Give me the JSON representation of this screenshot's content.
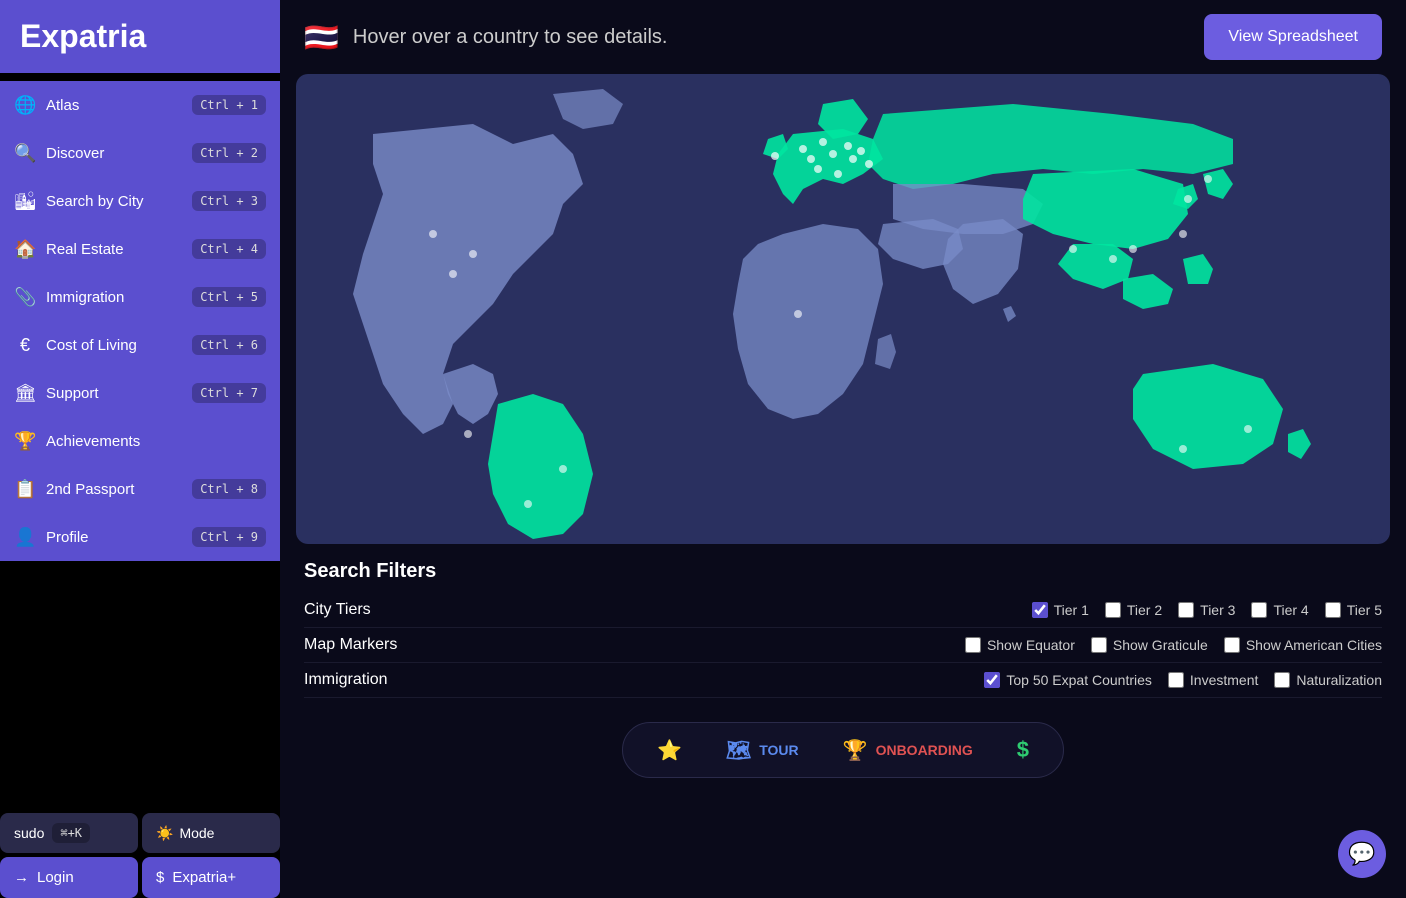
{
  "app": {
    "title": "Expatria"
  },
  "sidebar": {
    "items": [
      {
        "id": "atlas",
        "label": "Atlas",
        "icon": "🌐",
        "shortcut": "Ctrl + 1"
      },
      {
        "id": "discover",
        "label": "Discover",
        "icon": "🔍",
        "shortcut": "Ctrl + 2"
      },
      {
        "id": "search-by-city",
        "label": "Search by City",
        "icon": "🏙",
        "shortcut": "Ctrl + 3"
      },
      {
        "id": "real-estate",
        "label": "Real Estate",
        "icon": "🏠",
        "shortcut": "Ctrl + 4"
      },
      {
        "id": "immigration",
        "label": "Immigration",
        "icon": "📎",
        "shortcut": "Ctrl + 5"
      },
      {
        "id": "cost-of-living",
        "label": "Cost of Living",
        "icon": "€",
        "shortcut": "Ctrl + 6"
      },
      {
        "id": "support",
        "label": "Support",
        "icon": "🏛",
        "shortcut": "Ctrl + 7"
      },
      {
        "id": "achievements",
        "label": "Achievements",
        "icon": "🏆",
        "shortcut": ""
      },
      {
        "id": "2nd-passport",
        "label": "2nd Passport",
        "icon": "📋",
        "shortcut": "Ctrl + 8"
      },
      {
        "id": "profile",
        "label": "Profile",
        "icon": "👤",
        "shortcut": "Ctrl + 9"
      }
    ],
    "sudo_label": "sudo",
    "sudo_shortcut": "⌘+K",
    "mode_label": "Mode",
    "login_label": "Login",
    "expatria_plus_label": "Expatria+"
  },
  "header": {
    "flag": "🇹🇭",
    "hover_text": "Hover over a country to see details.",
    "view_spreadsheet_label": "View Spreadsheet"
  },
  "search_filters": {
    "title": "Search Filters",
    "rows": [
      {
        "id": "city-tiers",
        "label": "City Tiers",
        "controls": [
          {
            "id": "tier1",
            "label": "Tier 1",
            "checked": true
          },
          {
            "id": "tier2",
            "label": "Tier 2",
            "checked": false
          },
          {
            "id": "tier3",
            "label": "Tier 3",
            "checked": false
          },
          {
            "id": "tier4",
            "label": "Tier 4",
            "checked": false
          },
          {
            "id": "tier5",
            "label": "Tier 5",
            "checked": false
          }
        ]
      },
      {
        "id": "map-markers",
        "label": "Map Markers",
        "controls": [
          {
            "id": "show-equator",
            "label": "Show Equator",
            "checked": false
          },
          {
            "id": "show-graticule",
            "label": "Show Graticule",
            "checked": false
          },
          {
            "id": "show-american-cities",
            "label": "Show American Cities",
            "checked": false
          }
        ]
      },
      {
        "id": "immigration-filter",
        "label": "Immigration",
        "controls": [
          {
            "id": "top50-expat",
            "label": "Top 50 Expat Countries",
            "checked": true
          },
          {
            "id": "investment",
            "label": "Investment",
            "checked": false
          },
          {
            "id": "naturalization",
            "label": "Naturalization",
            "checked": false
          }
        ]
      }
    ]
  },
  "bottom_tabs": [
    {
      "id": "star",
      "icon": "⭐",
      "label": "",
      "color": "#f5a623"
    },
    {
      "id": "tour",
      "icon": "🗺",
      "label": "TOUR",
      "color": "#5b8aee"
    },
    {
      "id": "onboarding",
      "icon": "🏆",
      "label": "ONBOARDING",
      "color": "#e05252"
    },
    {
      "id": "dollar",
      "icon": "$",
      "label": "",
      "color": "#2ecc71"
    }
  ],
  "chat_button": {
    "icon": "💬"
  }
}
